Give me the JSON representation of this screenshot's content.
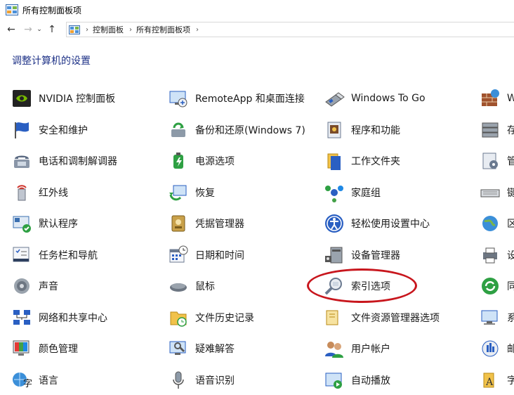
{
  "window": {
    "title": "所有控制面板项"
  },
  "address": {
    "breadcrumbs": [
      "控制面板",
      "所有控制面板项"
    ]
  },
  "heading": "调整计算机的设置",
  "columns": [
    [
      {
        "label": "NVIDIA 控制面板",
        "icon": "nvidia-icon"
      },
      {
        "label": "安全和维护",
        "icon": "flag-icon"
      },
      {
        "label": "电话和调制解调器",
        "icon": "phone-icon"
      },
      {
        "label": "红外线",
        "icon": "infrared-icon"
      },
      {
        "label": "默认程序",
        "icon": "default-programs-icon"
      },
      {
        "label": "任务栏和导航",
        "icon": "taskbar-icon"
      },
      {
        "label": "声音",
        "icon": "speaker-icon"
      },
      {
        "label": "网络和共享中心",
        "icon": "network-icon"
      },
      {
        "label": "颜色管理",
        "icon": "color-icon"
      },
      {
        "label": "语言",
        "icon": "language-icon"
      }
    ],
    [
      {
        "label": "RemoteApp 和桌面连接",
        "icon": "remoteapp-icon"
      },
      {
        "label": "备份和还原(Windows 7)",
        "icon": "backup-icon"
      },
      {
        "label": "电源选项",
        "icon": "power-icon"
      },
      {
        "label": "恢复",
        "icon": "recovery-icon"
      },
      {
        "label": "凭据管理器",
        "icon": "credential-icon"
      },
      {
        "label": "日期和时间",
        "icon": "calendar-icon"
      },
      {
        "label": "鼠标",
        "icon": "mouse-icon"
      },
      {
        "label": "文件历史记录",
        "icon": "file-history-icon"
      },
      {
        "label": "疑难解答",
        "icon": "troubleshoot-icon"
      },
      {
        "label": "语音识别",
        "icon": "microphone-icon"
      }
    ],
    [
      {
        "label": "Windows To Go",
        "icon": "usb-drive-icon"
      },
      {
        "label": "程序和功能",
        "icon": "programs-icon"
      },
      {
        "label": "工作文件夹",
        "icon": "work-folder-icon"
      },
      {
        "label": "家庭组",
        "icon": "homegroup-icon"
      },
      {
        "label": "轻松使用设置中心",
        "icon": "ease-of-access-icon"
      },
      {
        "label": "设备管理器",
        "icon": "device-manager-icon"
      },
      {
        "label": "索引选项",
        "icon": "indexing-icon"
      },
      {
        "label": "文件资源管理器选项",
        "icon": "folder-options-icon"
      },
      {
        "label": "用户帐户",
        "icon": "users-icon"
      },
      {
        "label": "自动播放",
        "icon": "autoplay-icon"
      }
    ],
    [
      {
        "label": "W",
        "icon": "firewall-icon"
      },
      {
        "label": "存",
        "icon": "storage-icon"
      },
      {
        "label": "管",
        "icon": "admin-tools-icon"
      },
      {
        "label": "键",
        "icon": "keyboard-icon"
      },
      {
        "label": "区",
        "icon": "region-icon"
      },
      {
        "label": "设",
        "icon": "devices-printers-icon"
      },
      {
        "label": "同",
        "icon": "sync-icon"
      },
      {
        "label": "系",
        "icon": "system-icon"
      },
      {
        "label": "邮",
        "icon": "mail-icon"
      },
      {
        "label": "字",
        "icon": "fonts-icon"
      }
    ]
  ],
  "colors": {
    "heading": "#1e3287",
    "highlight": "#c8161d"
  }
}
